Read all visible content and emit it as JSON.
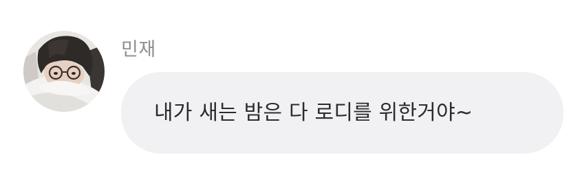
{
  "chat": {
    "message": {
      "sender_name": "민재",
      "text": "내가 새는 밤은 다 로디를 위한거야~",
      "avatar_icon": "profile-photo-avatar"
    }
  },
  "colors": {
    "bubble_background": "#f1f1f4",
    "sender_name": "#8e8e93",
    "message_text": "#2b2b2f",
    "page_background": "#ffffff"
  }
}
